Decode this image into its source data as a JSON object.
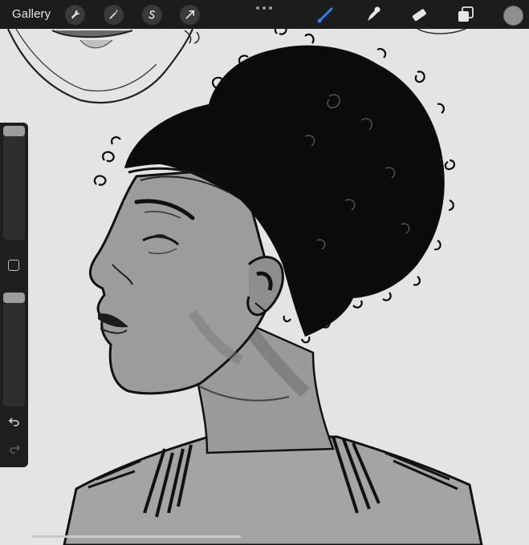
{
  "toolbar": {
    "gallery_label": "Gallery",
    "actions_icon": "wrench-icon",
    "adjustments_icon": "magic-wand-icon",
    "selection_icon": "selection-s-icon",
    "transform_icon": "arrow-cursor-icon",
    "more_icon": "ellipsis-icon",
    "brush_icon": "brush-icon",
    "smudge_icon": "smudge-icon",
    "eraser_icon": "eraser-icon",
    "layers_icon": "layers-icon",
    "active_tool_color": "#2f7ff0",
    "current_color": "#8f8f8f"
  },
  "sidebar": {
    "brush_size_slider": "size-slider",
    "modify_button": "square-icon",
    "opacity_slider": "opacity-slider",
    "undo_icon": "undo-icon",
    "redo_icon": "redo-icon"
  },
  "canvas": {
    "background": "#e4e4e4",
    "subject": "sketch-portrait"
  }
}
